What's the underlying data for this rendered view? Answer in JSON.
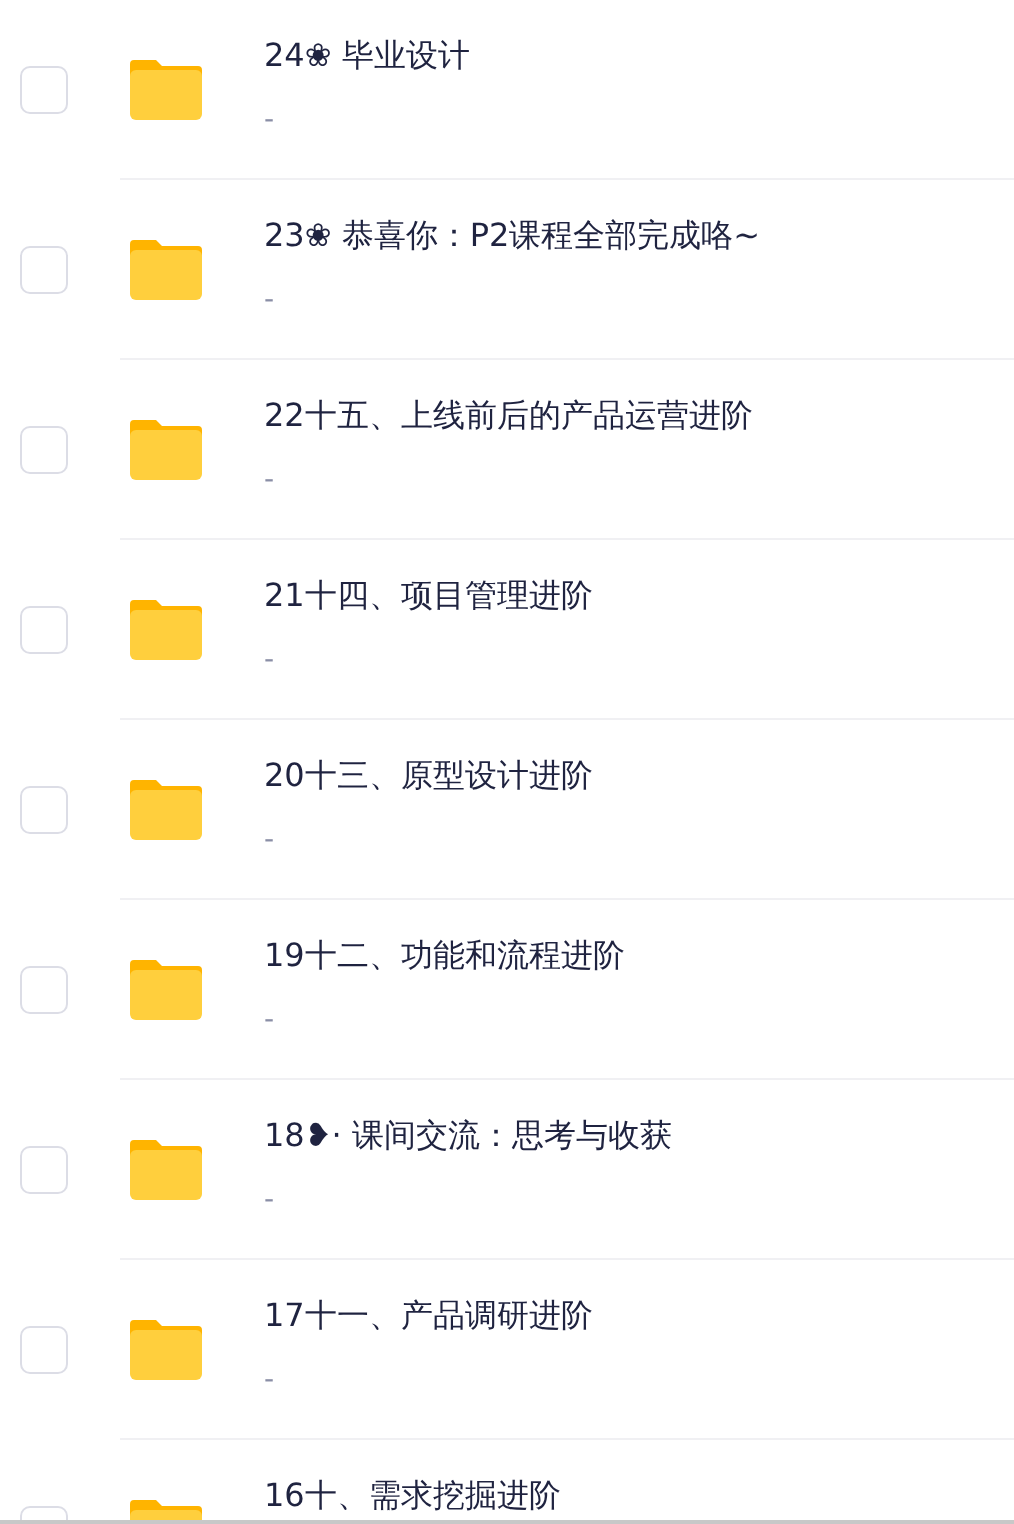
{
  "files": [
    {
      "title": "24❀ 毕业设计",
      "subtitle": "-",
      "checked": false
    },
    {
      "title": "23❀ 恭喜你：P2课程全部完成咯~",
      "subtitle": "-",
      "checked": false
    },
    {
      "title": "22十五、上线前后的产品运营进阶",
      "subtitle": "-",
      "checked": false
    },
    {
      "title": "21十四、项目管理进阶",
      "subtitle": "-",
      "checked": false
    },
    {
      "title": "20十三、原型设计进阶",
      "subtitle": "-",
      "checked": false
    },
    {
      "title": "19十二、功能和流程进阶",
      "subtitle": "-",
      "checked": false
    },
    {
      "title": "18❥· 课间交流：思考与收获",
      "subtitle": "-",
      "checked": false
    },
    {
      "title": "17十一、产品调研进阶",
      "subtitle": "-",
      "checked": false
    },
    {
      "title": "16十、需求挖掘进阶",
      "checked": false
    }
  ]
}
